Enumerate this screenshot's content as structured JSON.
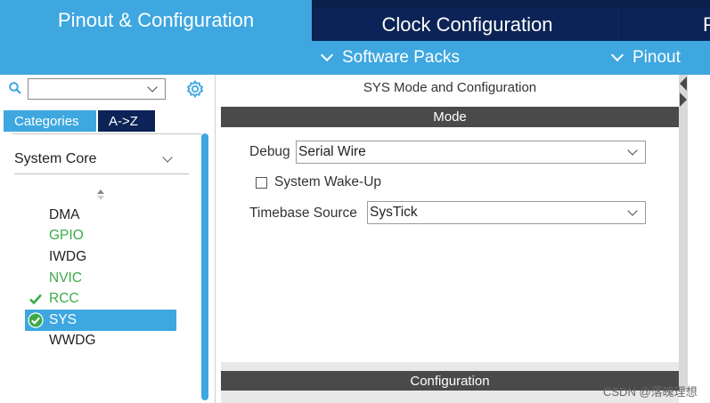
{
  "tabs": {
    "pinout": "Pinout & Configuration",
    "clock": "Clock Configuration",
    "more": "P"
  },
  "subbar": {
    "software_packs": "Software Packs",
    "pinout": "Pinout"
  },
  "left": {
    "search_value": "",
    "tab_categories": "Categories",
    "tab_az": "A->Z",
    "category": "System Core",
    "items": [
      {
        "label": "DMA",
        "state": "plain"
      },
      {
        "label": "GPIO",
        "state": "green"
      },
      {
        "label": "IWDG",
        "state": "plain"
      },
      {
        "label": "NVIC",
        "state": "green"
      },
      {
        "label": "RCC",
        "state": "checked"
      },
      {
        "label": "SYS",
        "state": "selected"
      },
      {
        "label": "WWDG",
        "state": "plain"
      }
    ]
  },
  "right": {
    "title": "SYS Mode and Configuration",
    "mode_header": "Mode",
    "debug_label": "Debug",
    "debug_value": "Serial Wire",
    "wakeup_label": "System Wake-Up",
    "timebase_label": "Timebase Source",
    "timebase_value": "SysTick",
    "config_header": "Configuration"
  },
  "watermark": "CSDN @落魄理想",
  "colors": {
    "accent": "#3ea7e0",
    "dark_nav": "#0b2356",
    "green": "#3bab48",
    "header_gray": "#4a4a4a"
  }
}
